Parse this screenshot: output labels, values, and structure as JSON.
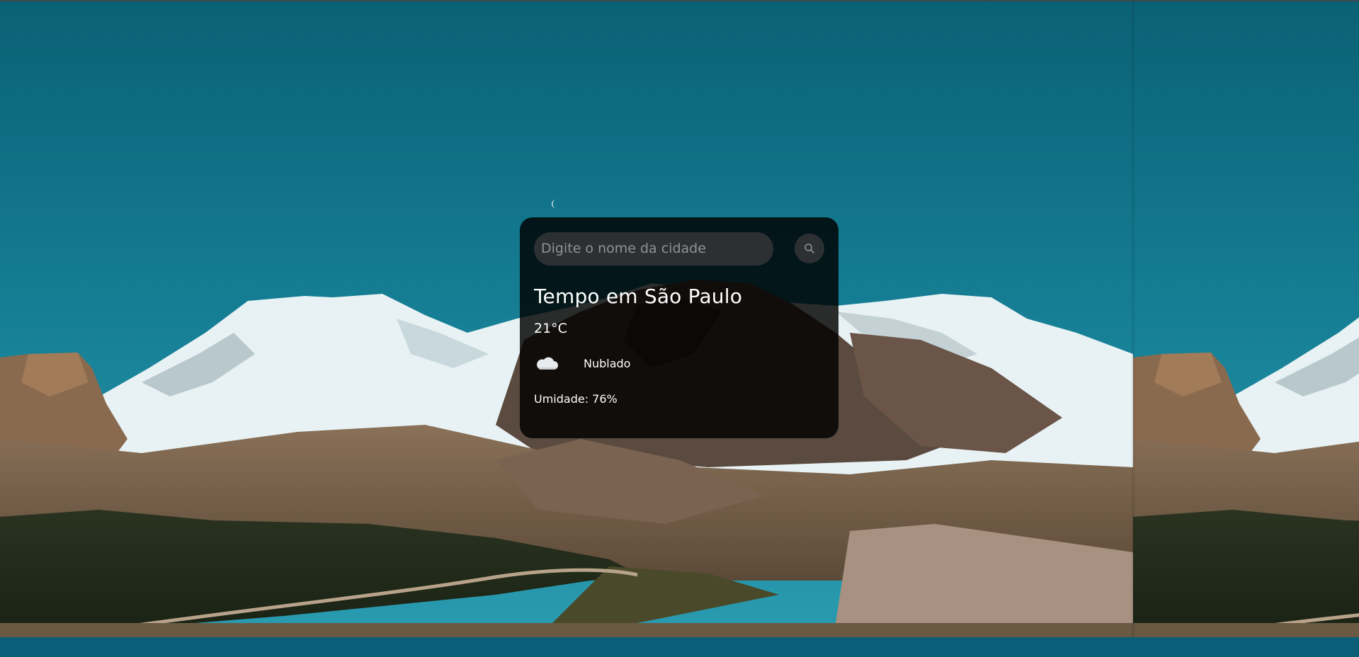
{
  "search": {
    "placeholder": "Digite o nome da cidade",
    "value": "",
    "button_icon": "search-icon"
  },
  "weather": {
    "title": "Tempo em São Paulo",
    "temperature": "21°C",
    "condition_icon": "cloud-icon",
    "condition": "Nublado",
    "humidity": "Umidade: 76%"
  },
  "colors": {
    "sky": "#0b6a80",
    "card_background": "rgba(0,0,0,0.82)",
    "input_background": "#2c3033",
    "text": "#ffffff"
  }
}
